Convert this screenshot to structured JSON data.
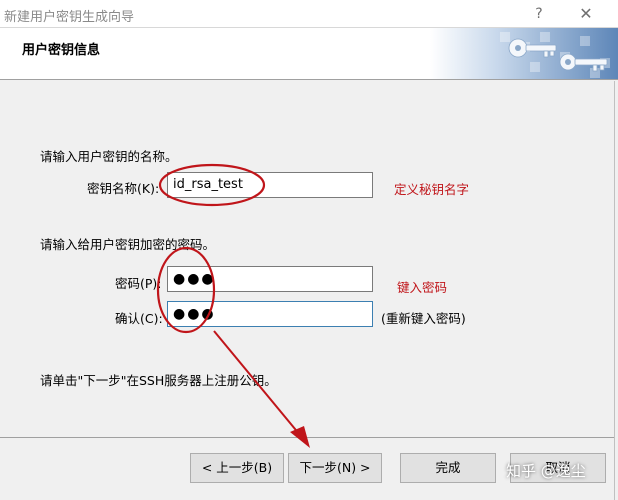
{
  "window": {
    "title": "新建用户密钥生成向导",
    "help_glyph": "?",
    "close_glyph": "✕"
  },
  "header": {
    "title": "用户密钥信息"
  },
  "key_name": {
    "instruction": "请输入用户密钥的名称。",
    "label": "密钥名称(K):",
    "value": "id_rsa_test",
    "annotation": "定义秘钥名字"
  },
  "password": {
    "instruction": "请输入给用户密钥加密的密码。",
    "label": "密码(P):",
    "value": "●●●",
    "annotation": "键入密码"
  },
  "confirm": {
    "label": "确认(C):",
    "value": "●●●",
    "hint": "(重新键入密码)"
  },
  "register_hint": "请单击\"下一步\"在SSH服务器上注册公钥。",
  "buttons": {
    "back": "< 上一步(B)",
    "next": "下一步(N) >",
    "finish": "完成",
    "cancel": "取消"
  },
  "watermark": "知乎 @逸尘",
  "colors": {
    "annotation": "#c0151a",
    "focus_border": "#3c7fb1",
    "banner_blue": "#4a7ab0"
  },
  "icons": {
    "banner": "key-banner-icon",
    "arrow": "red-arrow-icon"
  }
}
